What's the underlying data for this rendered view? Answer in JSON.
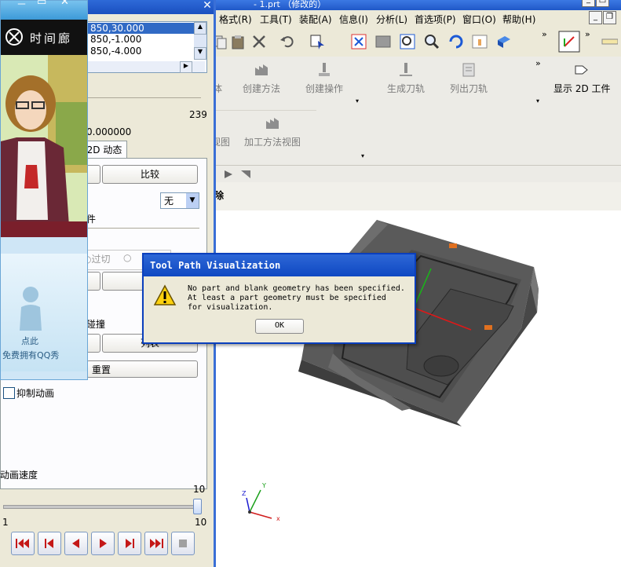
{
  "app": {
    "title_fragment": "- 1.prt （修改的）",
    "menu": [
      "格式(R)",
      "工具(T)",
      "装配(A)",
      "信息(I)",
      "分析(L)",
      "首选项(P)",
      "窗口(O)",
      "帮助(H)"
    ],
    "ribbon_row1": [
      "体",
      "创建方法",
      "创建操作",
      "生成刀轨",
      "列出刀轨",
      "显示 2D 工件"
    ],
    "ribbon_row2": [
      "视图",
      "加工方法视图"
    ],
    "column_header": "除"
  },
  "dialog": {
    "coords": [
      "850,30.000",
      "850,-1.000",
      "850,-4.000"
    ],
    "count": "239",
    "value_text": "0.000000",
    "tab_label": "2D 动态",
    "compare_button": "比较",
    "select_value": "无",
    "label_piece": "件",
    "radio_label": "过切",
    "collision_label": "碰撞",
    "list_button": "列表",
    "reset_button": "重置",
    "suppress_anim_label": "抑制动画",
    "anim_speed_label": "动画速度",
    "slider_max_top": "10",
    "slider_min": "1",
    "slider_max": "10"
  },
  "qq": {
    "brand": "时间廊",
    "promo_line1": "点此",
    "promo_line2": "免费拥有QQ秀"
  },
  "modal": {
    "title": "Tool Path Visualization",
    "line1": "No part and blank geometry has been specified.",
    "line2": "At least a part geometry must be specified",
    "line3": "for visualization.",
    "ok_label": "OK"
  },
  "triad": {
    "x": "x",
    "y": "Y",
    "z": "Z"
  }
}
